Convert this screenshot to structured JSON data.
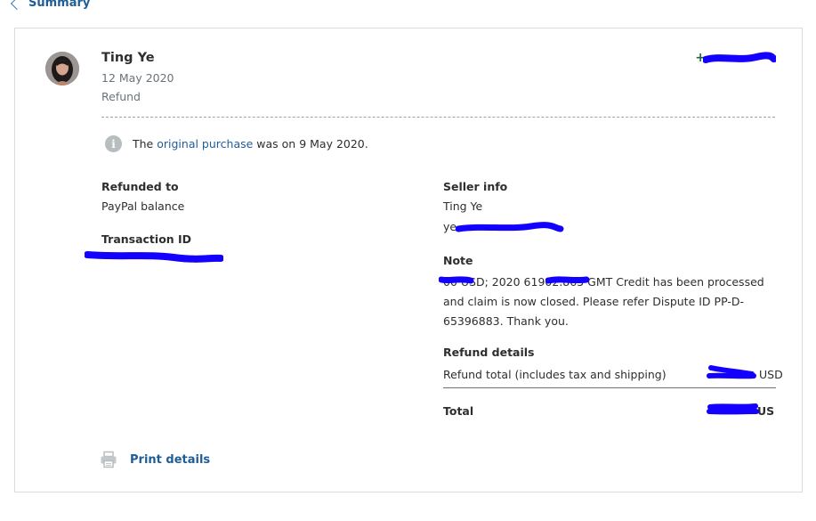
{
  "nav": {
    "back_label": "Summary"
  },
  "transaction": {
    "name": "Ting Ye",
    "date": "12 May 2020",
    "type": "Refund",
    "amount_prefix": "+",
    "amount_visible": "",
    "info": {
      "pre": "The ",
      "link": "original purchase",
      "post": " was on 9 May 2020."
    }
  },
  "left": {
    "refunded_to_label": "Refunded to",
    "refunded_to_value": "PayPal balance",
    "transaction_id_label": "Transaction ID"
  },
  "right": {
    "seller_info_label": "Seller info",
    "seller_name": "Ting Ye",
    "seller_email_fragment": "ye",
    "note_label": "Note",
    "note_text": "00 USD; 2020 61902.865 GMT Credit has been processed and claim is now closed. Please refer Dispute ID PP-D-65396883. Thank you.",
    "refund_details_label": "Refund details",
    "refund_total_label": "Refund total (includes tax and shipping)",
    "refund_total_suffix": "USD",
    "total_label": "Total",
    "total_suffix": "US"
  },
  "footer": {
    "print_label": "Print details"
  },
  "colors": {
    "link": "#1f5d97",
    "positive": "#1b6b3c",
    "redaction": "#1400ff",
    "muted": "#6c7378"
  }
}
